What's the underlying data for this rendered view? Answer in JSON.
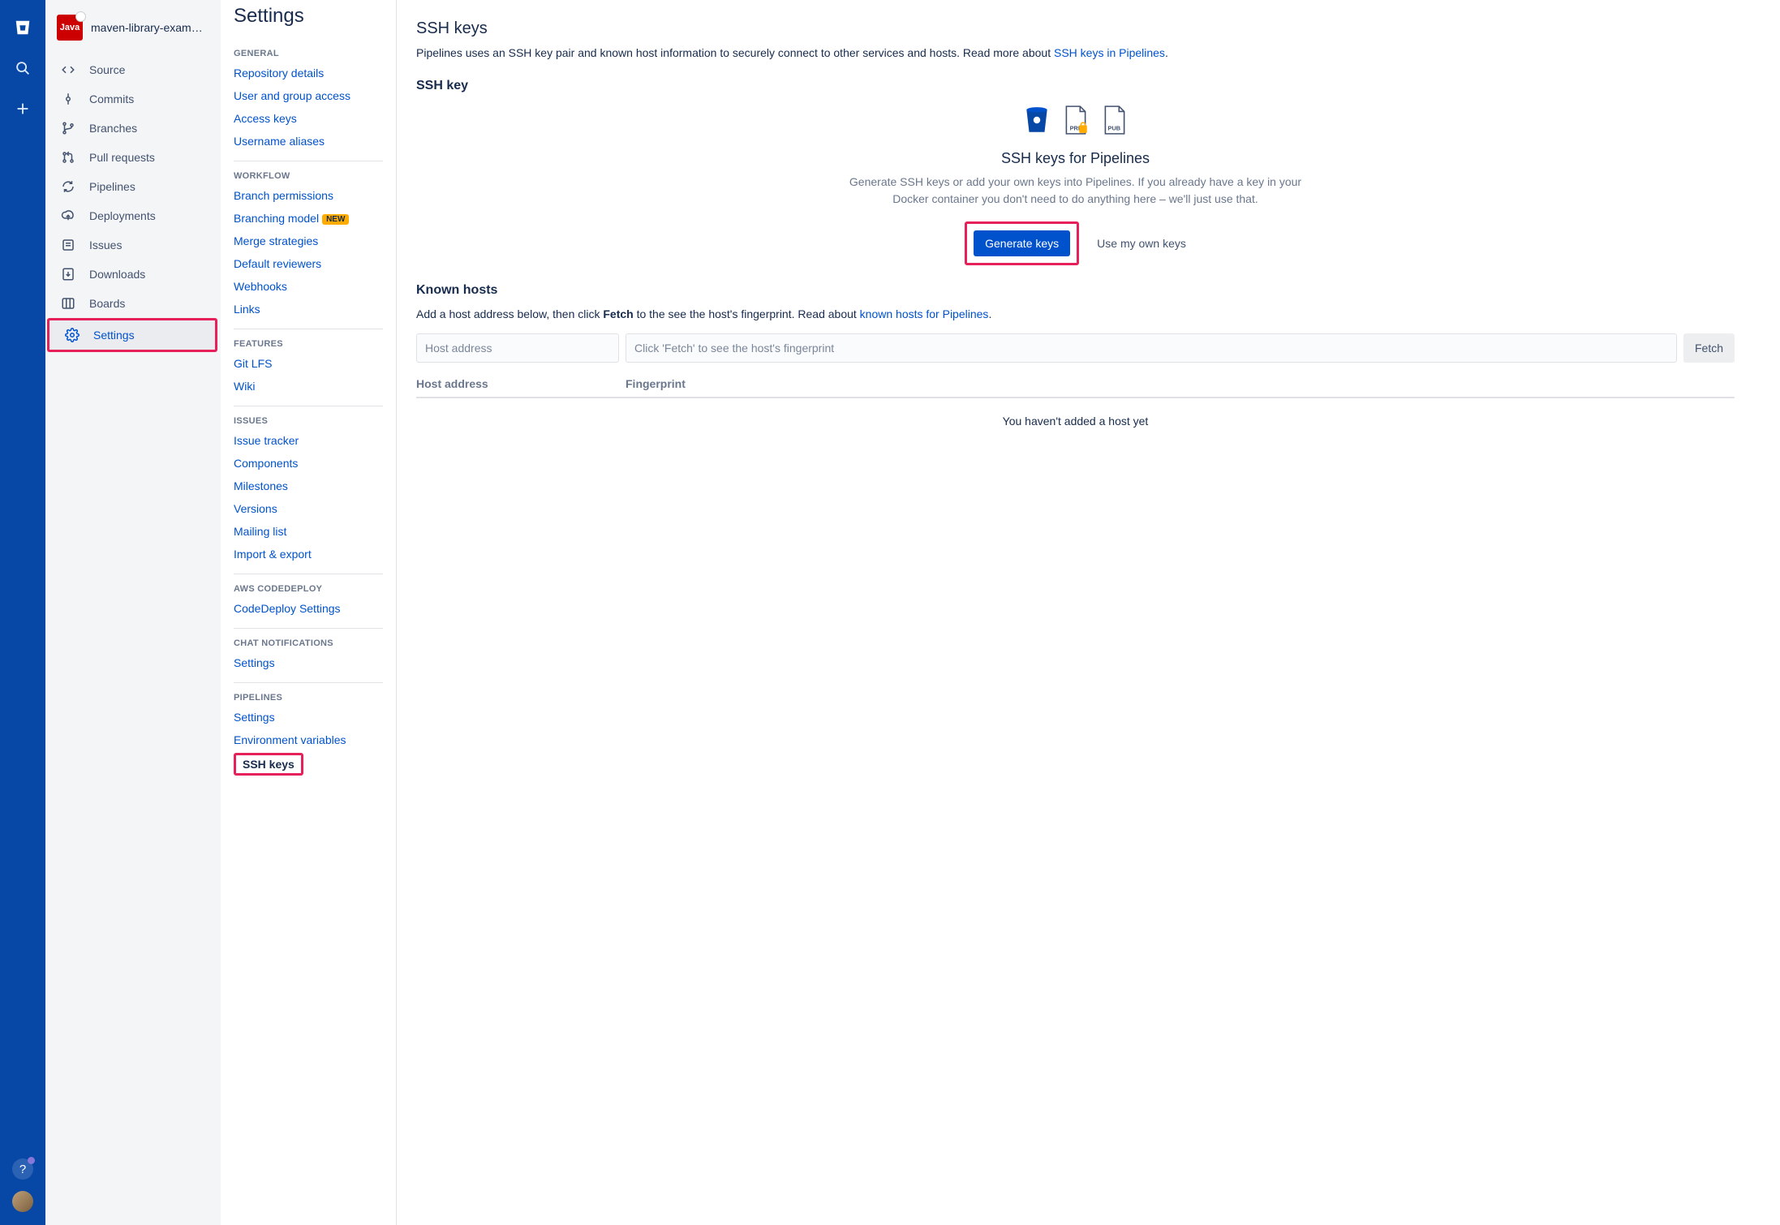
{
  "repo": {
    "name": "maven-library-exam…",
    "logo_text": "Java"
  },
  "repo_nav": [
    {
      "id": "source",
      "label": "Source"
    },
    {
      "id": "commits",
      "label": "Commits"
    },
    {
      "id": "branches",
      "label": "Branches"
    },
    {
      "id": "pull-requests",
      "label": "Pull requests"
    },
    {
      "id": "pipelines",
      "label": "Pipelines"
    },
    {
      "id": "deployments",
      "label": "Deployments"
    },
    {
      "id": "issues",
      "label": "Issues"
    },
    {
      "id": "downloads",
      "label": "Downloads"
    },
    {
      "id": "boards",
      "label": "Boards"
    },
    {
      "id": "settings",
      "label": "Settings",
      "active": true,
      "highlight": true
    }
  ],
  "settings": {
    "title": "Settings",
    "groups": [
      {
        "head": "GENERAL",
        "items": [
          {
            "label": "Repository details"
          },
          {
            "label": "User and group access"
          },
          {
            "label": "Access keys"
          },
          {
            "label": "Username aliases"
          }
        ]
      },
      {
        "head": "WORKFLOW",
        "items": [
          {
            "label": "Branch permissions"
          },
          {
            "label": "Branching model",
            "badge": "NEW"
          },
          {
            "label": "Merge strategies"
          },
          {
            "label": "Default reviewers"
          },
          {
            "label": "Webhooks"
          },
          {
            "label": "Links"
          }
        ]
      },
      {
        "head": "FEATURES",
        "items": [
          {
            "label": "Git LFS"
          },
          {
            "label": "Wiki"
          }
        ]
      },
      {
        "head": "ISSUES",
        "items": [
          {
            "label": "Issue tracker"
          },
          {
            "label": "Components"
          },
          {
            "label": "Milestones"
          },
          {
            "label": "Versions"
          },
          {
            "label": "Mailing list"
          },
          {
            "label": "Import & export"
          }
        ]
      },
      {
        "head": "AWS CODEDEPLOY",
        "items": [
          {
            "label": "CodeDeploy Settings"
          }
        ]
      },
      {
        "head": "CHAT NOTIFICATIONS",
        "items": [
          {
            "label": "Settings"
          }
        ]
      },
      {
        "head": "PIPELINES",
        "items": [
          {
            "label": "Settings"
          },
          {
            "label": "Environment variables"
          },
          {
            "label": "SSH keys",
            "highlight": true
          }
        ]
      }
    ]
  },
  "main": {
    "heading": "SSH keys",
    "intro_prefix": "Pipelines uses an SSH key pair and known host information to securely connect to other services and hosts. Read more about ",
    "intro_link": "SSH keys in Pipelines",
    "intro_suffix": ".",
    "ssh_section_label": "SSH key",
    "panel_title": "SSH keys for Pipelines",
    "panel_desc": "Generate SSH keys or add your own keys into Pipelines. If you already have a key in your Docker container you don't need to do anything here – we'll just use that.",
    "generate_btn": "Generate keys",
    "use_own": "Use my own keys",
    "known_hosts_heading": "Known hosts",
    "known_hosts_text_prefix": "Add a host address below, then click ",
    "known_hosts_text_bold": "Fetch",
    "known_hosts_text_middle": " to the see the host's fingerprint. Read about ",
    "known_hosts_link": "known hosts for Pipelines",
    "known_hosts_text_suffix": ".",
    "host_placeholder": "Host address",
    "fingerprint_placeholder": "Click 'Fetch' to see the host's fingerprint",
    "fetch_btn": "Fetch",
    "col_host": "Host address",
    "col_fingerprint": "Fingerprint",
    "empty_hosts": "You haven't added a host yet"
  }
}
